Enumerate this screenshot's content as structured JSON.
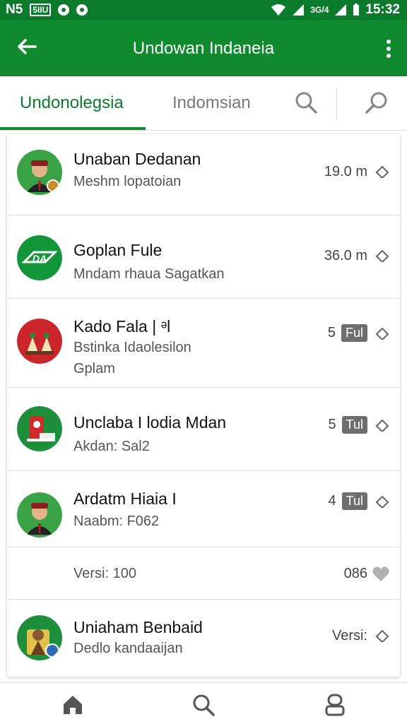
{
  "status_bar": {
    "left_text": "N5",
    "left_box": "5IIU",
    "signal_text": "3G/4",
    "time": "15:32"
  },
  "app_bar": {
    "title": "Undowan Indaneia"
  },
  "tabs": {
    "active": "Undonolegsia",
    "inactive": "Indomsian"
  },
  "rows": [
    {
      "name": "Unaban Dedanan",
      "subtitle": "Meshm lopatoian",
      "value": "19.0 m",
      "badge": "",
      "avatar": "person-avatar"
    },
    {
      "name": "Goplan Fule",
      "subtitle": "Mndam rhaua Sagatkan",
      "value": "36.0 m",
      "badge": "",
      "avatar": "logo-avatar"
    },
    {
      "name": "Kado Fala | ᵊl",
      "subtitle": "Bstinka Idaolesilon",
      "subtitle2": "Gplam",
      "value": "5",
      "badge": "Ful",
      "avatar": "decor-avatar"
    },
    {
      "name": "Unclaba I lodia Mdan",
      "subtitle": "Akdan: Sal2",
      "value": "5",
      "badge": "Tul",
      "avatar": "device-avatar"
    },
    {
      "name": "Ardatm Hiaia I",
      "subtitle": "Naabm: F062",
      "value": "4",
      "badge": "Tul",
      "avatar": "person-avatar"
    }
  ],
  "footer_row": {
    "left": "Versi: 100",
    "right": "086"
  },
  "last_row": {
    "name": "Uniaham Benbaid",
    "subtitle": "Dedlo kandaaijan",
    "value": "Versi:",
    "avatar": "figure-avatar"
  },
  "colors": {
    "primary": "#0f8a2f",
    "primary_dark": "#0c7a2c",
    "badge": "#6e6e6e"
  },
  "icons": [
    "back-arrow-icon",
    "more-vert-icon",
    "search-icon",
    "search-alt-icon",
    "chevron-up-icon",
    "heart-icon",
    "home-icon",
    "search-nav-icon",
    "profile-icon"
  ]
}
